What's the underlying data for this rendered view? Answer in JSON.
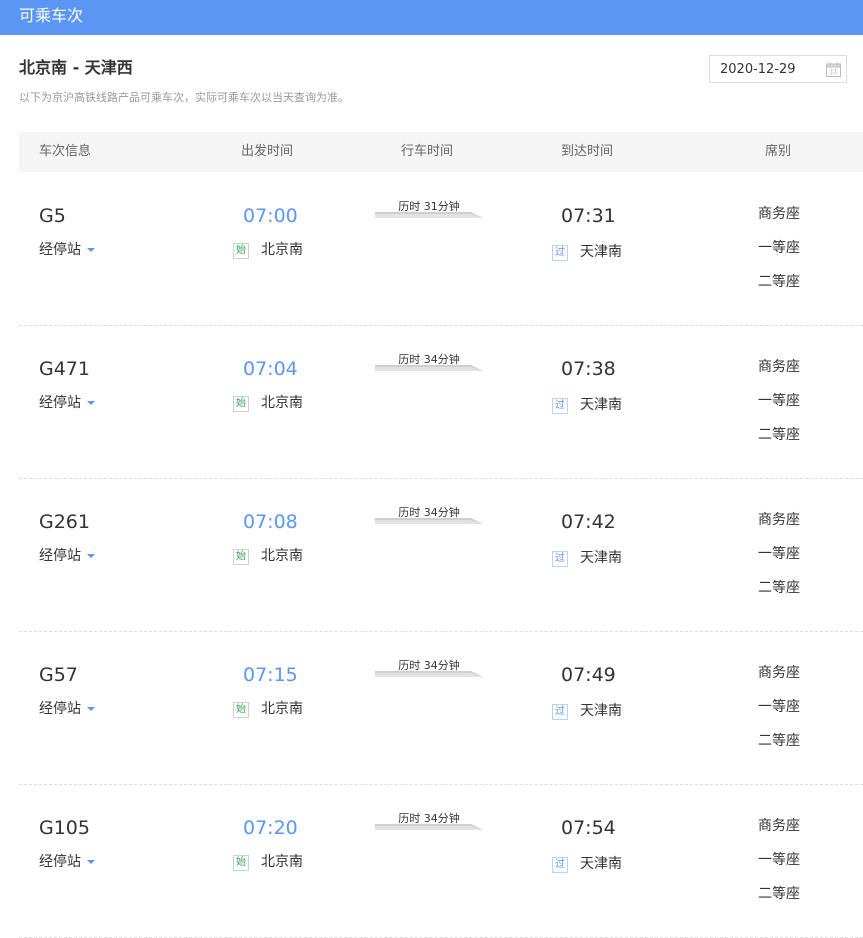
{
  "header": {
    "title": "可乘车次"
  },
  "query": {
    "route": "北京南 - 天津西",
    "note": "以下为京沪高铁线路产品可乘车次，实际可乘车次以当天查询为准。",
    "date": "2020-12-29"
  },
  "columns": {
    "train": "车次信息",
    "depart": "出发时间",
    "duration": "行车时间",
    "arrive": "到达时间",
    "seat": "席别"
  },
  "stops_label": "经停站",
  "tags": {
    "start": "始",
    "pass": "过"
  },
  "trains": [
    {
      "no": "G5",
      "dep_time": "07:00",
      "dep_station": "北京南",
      "duration": "历时 31分钟",
      "arr_time": "07:31",
      "arr_station": "天津南",
      "seats": [
        "商务座",
        "一等座",
        "二等座"
      ]
    },
    {
      "no": "G471",
      "dep_time": "07:04",
      "dep_station": "北京南",
      "duration": "历时 34分钟",
      "arr_time": "07:38",
      "arr_station": "天津南",
      "seats": [
        "商务座",
        "一等座",
        "二等座"
      ]
    },
    {
      "no": "G261",
      "dep_time": "07:08",
      "dep_station": "北京南",
      "duration": "历时 34分钟",
      "arr_time": "07:42",
      "arr_station": "天津南",
      "seats": [
        "商务座",
        "一等座",
        "二等座"
      ]
    },
    {
      "no": "G57",
      "dep_time": "07:15",
      "dep_station": "北京南",
      "duration": "历时 34分钟",
      "arr_time": "07:49",
      "arr_station": "天津南",
      "seats": [
        "商务座",
        "一等座",
        "二等座"
      ]
    },
    {
      "no": "G105",
      "dep_time": "07:20",
      "dep_station": "北京南",
      "duration": "历时 34分钟",
      "arr_time": "07:54",
      "arr_station": "天津南",
      "seats": [
        "商务座",
        "一等座",
        "二等座"
      ]
    }
  ],
  "colors": {
    "accent": "#5b96f4",
    "start_tag": "#3aa554",
    "header_bg": "#f5f5f5"
  },
  "icons": {
    "date": "calendar-icon",
    "stops": "caret-down-icon",
    "duration": "arrow-line-icon"
  }
}
